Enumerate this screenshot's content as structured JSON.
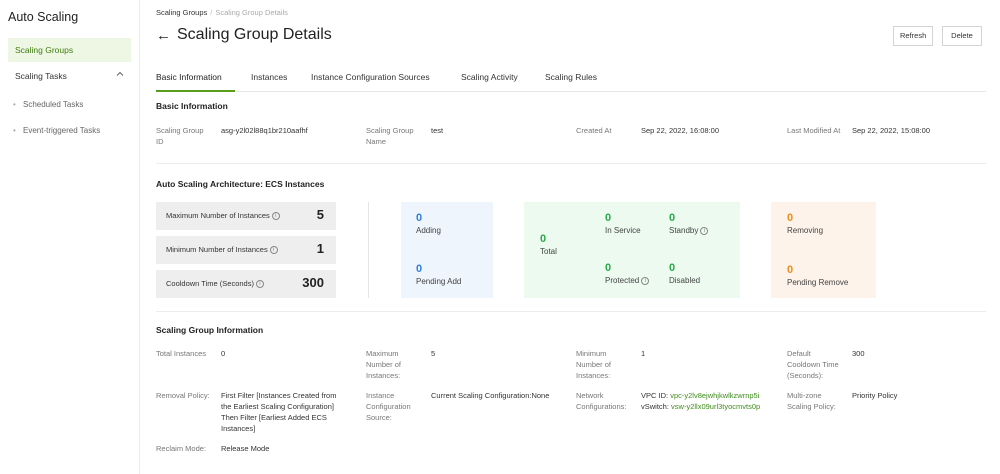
{
  "sidebar": {
    "title": "Auto Scaling",
    "active_item": "Scaling Groups",
    "tasks_label": "Scaling Tasks",
    "sub_items": [
      "Scheduled Tasks",
      "Event-triggered Tasks"
    ]
  },
  "header": {
    "breadcrumb_root": "Scaling Groups",
    "breadcrumb_sep": "/",
    "breadcrumb_current": "Scaling Group Details",
    "back_arrow": "←",
    "title": "Scaling Group Details",
    "refresh_label": "Refresh",
    "delete_label": "Delete"
  },
  "tabs": [
    "Basic Information",
    "Instances",
    "Instance Configuration Sources",
    "Scaling Activity",
    "Scaling Rules"
  ],
  "basic": {
    "title": "Basic Information",
    "group_id_label_1": "Scaling Group",
    "group_id_label_2": "ID",
    "group_id": "asg-y2l02l88q1br210aafhf",
    "group_name_label_1": "Scaling Group",
    "group_name_label_2": "Name",
    "group_name": "test",
    "created_label": "Created At",
    "created": "Sep 22, 2022, 16:08:00",
    "modified_label": "Last Modified At",
    "modified": "Sep 22, 2022, 15:08:00"
  },
  "arch": {
    "title": "Auto Scaling Architecture: ECS Instances",
    "max_label": "Maximum Number of Instances",
    "max_value": "5",
    "min_label": "Minimum Number of Instances",
    "min_value": "1",
    "cooldown_label": "Cooldown Time (Seconds)",
    "cooldown_value": "300",
    "adding_count": "0",
    "adding_label": "Adding",
    "pending_add_count": "0",
    "pending_add_label": "Pending Add",
    "total_count": "0",
    "total_label": "Total",
    "in_service_count": "0",
    "in_service_label": "In Service",
    "standby_count": "0",
    "standby_label": "Standby",
    "protected_count": "0",
    "protected_label": "Protected",
    "disabled_count": "0",
    "disabled_label": "Disabled",
    "removing_count": "0",
    "removing_label": "Removing",
    "pending_remove_count": "0",
    "pending_remove_label": "Pending Remove"
  },
  "info": {
    "title": "Scaling Group Information",
    "total_label": "Total Instances",
    "total_value": "0",
    "max_label": [
      "Maximum",
      "Number of",
      "Instances:"
    ],
    "max_value": "5",
    "min_label": [
      "Minimum",
      "Number of",
      "Instances:"
    ],
    "min_value": "1",
    "cooldown_label": [
      "Default",
      "Cooldown Time",
      "(Seconds):"
    ],
    "cooldown_value": "300",
    "removal_label": "Removal Policy:",
    "removal_value": [
      "First Filter [Instances Created from",
      "the Earliest Scaling Configuration]",
      "Then Filter [Earliest Added ECS",
      "Instances]"
    ],
    "config_label": [
      "Instance",
      "Configuration",
      "Source:"
    ],
    "config_value": "Current Scaling Configuration:None",
    "network_label": [
      "Network",
      "Configurations:"
    ],
    "vpc_prefix": "VPC ID:",
    "vpc_id": "vpc-y2lv8ejwhjkwlkzwrnp5i",
    "vswitch_prefix": "vSwitch:",
    "vswitch_id": "vsw-y2llx09url3tyocmvts0p",
    "multizone_label": [
      "Multi-zone",
      "Scaling Policy:"
    ],
    "multizone_value": "Priority Policy",
    "reclaim_label": "Reclaim Mode:",
    "reclaim_value": "Release Mode"
  },
  "colors": {
    "accent_green": "#5a9d1a",
    "blue": "#2f7fd6",
    "green": "#2aa84a",
    "orange": "#f08c1e"
  }
}
